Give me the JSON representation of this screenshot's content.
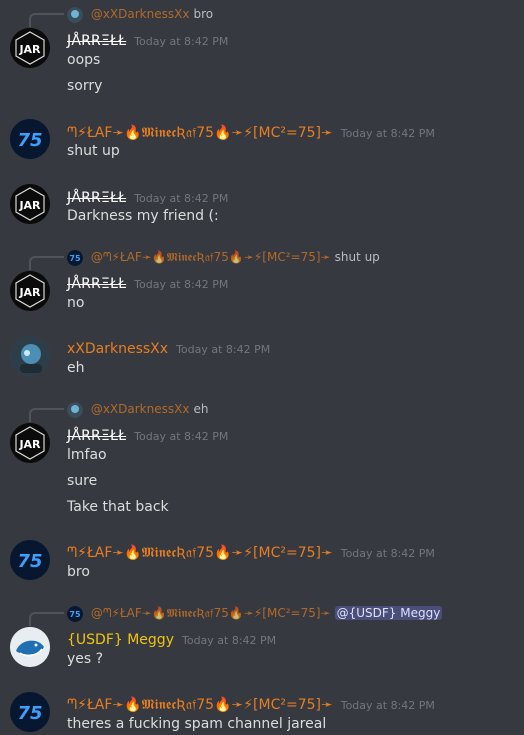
{
  "timestamp": "Today at 8:42 PM",
  "messages": [
    {
      "id": "m1",
      "author": "JARRELL",
      "author_display": "JÅRRΞŁŁ",
      "avatar": "jar",
      "reply": {
        "author": "@xXDarknessXx",
        "text": "bro",
        "avatar": "dark"
      },
      "lines": [
        "oops",
        "sorry"
      ]
    },
    {
      "id": "m2",
      "author_display": "ᘉ⚡ŁAF➛🔥𝕸𝖎𝖓𝖊𝖈Ʀ𝔞𝔣75🔥➛⚡[MC²=75]➛",
      "avatar": "75",
      "lines": [
        "shut up"
      ]
    },
    {
      "id": "m3",
      "author_display": "JÅRRΞŁŁ",
      "avatar": "jar",
      "lines": [
        "Darkness my friend (:"
      ]
    },
    {
      "id": "m4",
      "author_display": "JÅRRΞŁŁ",
      "avatar": "jar",
      "reply": {
        "author": "@ᘉ⚡ŁAF➛🔥𝕸𝖎𝖓𝖊𝖈Ʀ𝔞𝔣75🔥➛⚡[MC²=75]➛",
        "text": "shut up",
        "avatar": "75"
      },
      "lines": [
        "no"
      ]
    },
    {
      "id": "m5",
      "author_display": "xXDarknessXx",
      "avatar": "dark",
      "lines": [
        "eh"
      ]
    },
    {
      "id": "m6",
      "author_display": "JÅRRΞŁŁ",
      "avatar": "jar",
      "reply": {
        "author": "@xXDarknessXx",
        "text": "eh",
        "avatar": "dark"
      },
      "lines": [
        "lmfao",
        "sure",
        "Take that back"
      ]
    },
    {
      "id": "m7",
      "author_display": "ᘉ⚡ŁAF➛🔥𝕸𝖎𝖓𝖊𝖈Ʀ𝔞𝔣75🔥➛⚡[MC²=75]➛",
      "avatar": "75",
      "lines": [
        "bro"
      ]
    },
    {
      "id": "m8",
      "author_display": "{USDF} Meggy",
      "avatar": "whale",
      "reply": {
        "author": "@ᘉ⚡ŁAF➛🔥𝕸𝖎𝖓𝖊𝖈Ʀ𝔞𝔣75🔥➛⚡[MC²=75]➛",
        "text": "",
        "mention": "@{USDF} Meggy",
        "avatar": "75"
      },
      "lines": [
        "yes ?"
      ]
    },
    {
      "id": "m9",
      "author_display": "ᘉ⚡ŁAF➛🔥𝕸𝖎𝖓𝖊𝖈Ʀ𝔞𝔣75🔥➛⚡[MC²=75]➛",
      "avatar": "75",
      "lines": [
        "theres a fucking spam channel jareal"
      ]
    }
  ],
  "colors": {
    "background": "#36393f",
    "text": "#dcddde",
    "timestamp": "#72767d",
    "orange": "#e67e22",
    "gold": "#f1c40f",
    "mention_bg": "#4a4f7a"
  },
  "icons": {
    "jar": "jar-badge-icon",
    "75": "seventy-five-badge-icon",
    "dark": "robot-avatar-icon",
    "whale": "whale-avatar-icon"
  }
}
